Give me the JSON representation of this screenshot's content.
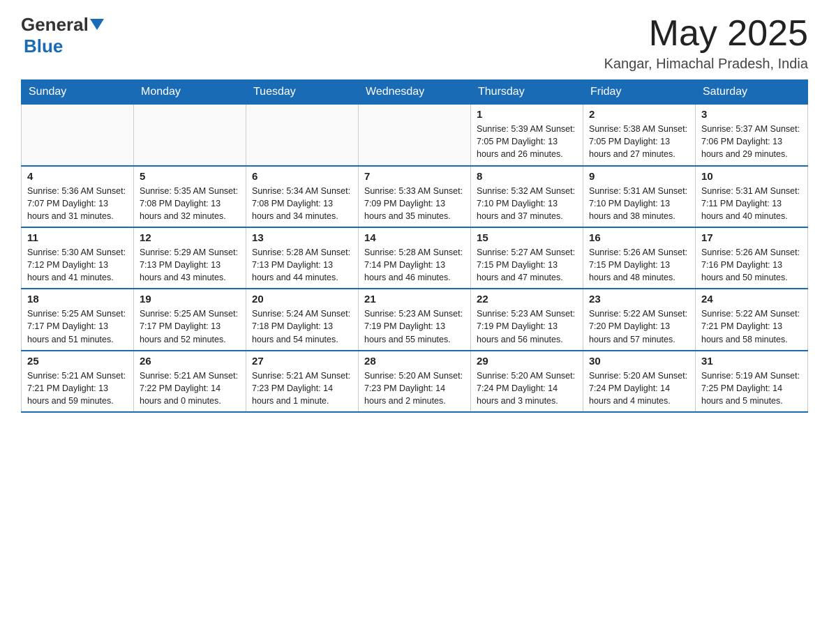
{
  "header": {
    "logo_general": "General",
    "logo_blue": "Blue",
    "month_title": "May 2025",
    "location": "Kangar, Himachal Pradesh, India"
  },
  "weekdays": [
    "Sunday",
    "Monday",
    "Tuesday",
    "Wednesday",
    "Thursday",
    "Friday",
    "Saturday"
  ],
  "weeks": [
    [
      {
        "day": "",
        "info": ""
      },
      {
        "day": "",
        "info": ""
      },
      {
        "day": "",
        "info": ""
      },
      {
        "day": "",
        "info": ""
      },
      {
        "day": "1",
        "info": "Sunrise: 5:39 AM\nSunset: 7:05 PM\nDaylight: 13 hours and 26 minutes."
      },
      {
        "day": "2",
        "info": "Sunrise: 5:38 AM\nSunset: 7:05 PM\nDaylight: 13 hours and 27 minutes."
      },
      {
        "day": "3",
        "info": "Sunrise: 5:37 AM\nSunset: 7:06 PM\nDaylight: 13 hours and 29 minutes."
      }
    ],
    [
      {
        "day": "4",
        "info": "Sunrise: 5:36 AM\nSunset: 7:07 PM\nDaylight: 13 hours and 31 minutes."
      },
      {
        "day": "5",
        "info": "Sunrise: 5:35 AM\nSunset: 7:08 PM\nDaylight: 13 hours and 32 minutes."
      },
      {
        "day": "6",
        "info": "Sunrise: 5:34 AM\nSunset: 7:08 PM\nDaylight: 13 hours and 34 minutes."
      },
      {
        "day": "7",
        "info": "Sunrise: 5:33 AM\nSunset: 7:09 PM\nDaylight: 13 hours and 35 minutes."
      },
      {
        "day": "8",
        "info": "Sunrise: 5:32 AM\nSunset: 7:10 PM\nDaylight: 13 hours and 37 minutes."
      },
      {
        "day": "9",
        "info": "Sunrise: 5:31 AM\nSunset: 7:10 PM\nDaylight: 13 hours and 38 minutes."
      },
      {
        "day": "10",
        "info": "Sunrise: 5:31 AM\nSunset: 7:11 PM\nDaylight: 13 hours and 40 minutes."
      }
    ],
    [
      {
        "day": "11",
        "info": "Sunrise: 5:30 AM\nSunset: 7:12 PM\nDaylight: 13 hours and 41 minutes."
      },
      {
        "day": "12",
        "info": "Sunrise: 5:29 AM\nSunset: 7:13 PM\nDaylight: 13 hours and 43 minutes."
      },
      {
        "day": "13",
        "info": "Sunrise: 5:28 AM\nSunset: 7:13 PM\nDaylight: 13 hours and 44 minutes."
      },
      {
        "day": "14",
        "info": "Sunrise: 5:28 AM\nSunset: 7:14 PM\nDaylight: 13 hours and 46 minutes."
      },
      {
        "day": "15",
        "info": "Sunrise: 5:27 AM\nSunset: 7:15 PM\nDaylight: 13 hours and 47 minutes."
      },
      {
        "day": "16",
        "info": "Sunrise: 5:26 AM\nSunset: 7:15 PM\nDaylight: 13 hours and 48 minutes."
      },
      {
        "day": "17",
        "info": "Sunrise: 5:26 AM\nSunset: 7:16 PM\nDaylight: 13 hours and 50 minutes."
      }
    ],
    [
      {
        "day": "18",
        "info": "Sunrise: 5:25 AM\nSunset: 7:17 PM\nDaylight: 13 hours and 51 minutes."
      },
      {
        "day": "19",
        "info": "Sunrise: 5:25 AM\nSunset: 7:17 PM\nDaylight: 13 hours and 52 minutes."
      },
      {
        "day": "20",
        "info": "Sunrise: 5:24 AM\nSunset: 7:18 PM\nDaylight: 13 hours and 54 minutes."
      },
      {
        "day": "21",
        "info": "Sunrise: 5:23 AM\nSunset: 7:19 PM\nDaylight: 13 hours and 55 minutes."
      },
      {
        "day": "22",
        "info": "Sunrise: 5:23 AM\nSunset: 7:19 PM\nDaylight: 13 hours and 56 minutes."
      },
      {
        "day": "23",
        "info": "Sunrise: 5:22 AM\nSunset: 7:20 PM\nDaylight: 13 hours and 57 minutes."
      },
      {
        "day": "24",
        "info": "Sunrise: 5:22 AM\nSunset: 7:21 PM\nDaylight: 13 hours and 58 minutes."
      }
    ],
    [
      {
        "day": "25",
        "info": "Sunrise: 5:21 AM\nSunset: 7:21 PM\nDaylight: 13 hours and 59 minutes."
      },
      {
        "day": "26",
        "info": "Sunrise: 5:21 AM\nSunset: 7:22 PM\nDaylight: 14 hours and 0 minutes."
      },
      {
        "day": "27",
        "info": "Sunrise: 5:21 AM\nSunset: 7:23 PM\nDaylight: 14 hours and 1 minute."
      },
      {
        "day": "28",
        "info": "Sunrise: 5:20 AM\nSunset: 7:23 PM\nDaylight: 14 hours and 2 minutes."
      },
      {
        "day": "29",
        "info": "Sunrise: 5:20 AM\nSunset: 7:24 PM\nDaylight: 14 hours and 3 minutes."
      },
      {
        "day": "30",
        "info": "Sunrise: 5:20 AM\nSunset: 7:24 PM\nDaylight: 14 hours and 4 minutes."
      },
      {
        "day": "31",
        "info": "Sunrise: 5:19 AM\nSunset: 7:25 PM\nDaylight: 14 hours and 5 minutes."
      }
    ]
  ]
}
